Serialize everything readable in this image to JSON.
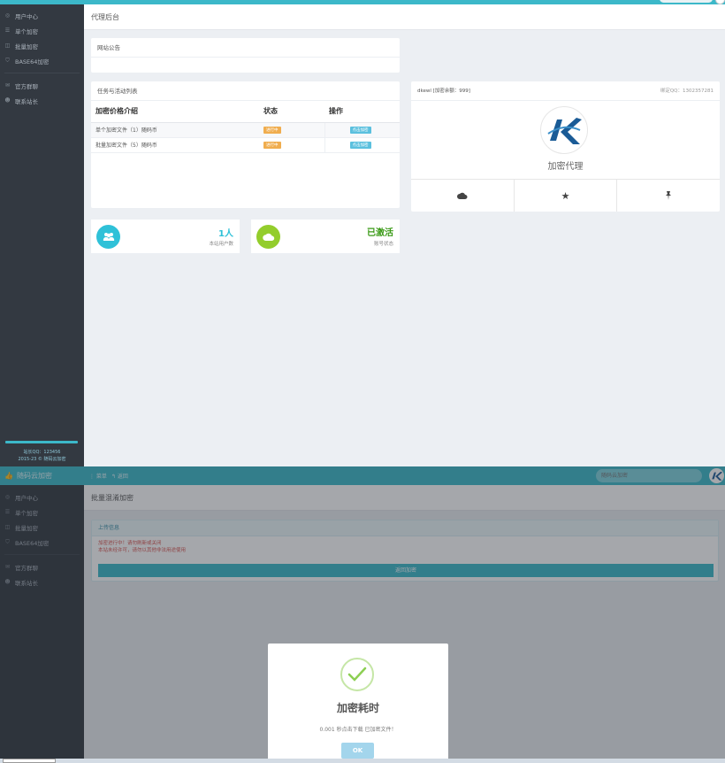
{
  "pane1": {
    "sidebar": {
      "items": [
        {
          "label": "用户中心",
          "icon": "user-circle-icon"
        },
        {
          "label": "单个加密",
          "icon": "list-icon"
        },
        {
          "label": "批量加密",
          "icon": "file-icon"
        },
        {
          "label": "BASE64加密",
          "icon": "shield-icon"
        }
      ],
      "items2": [
        {
          "label": "官方群聊",
          "icon": "chat-icon"
        },
        {
          "label": "联系站长",
          "icon": "user-group-icon"
        }
      ],
      "footer_qq": "站长QQ：123456",
      "footer_copy": "2015-23 © 随码云加密"
    },
    "page_title": "代理后台",
    "notice": {
      "title": "网站公告"
    },
    "tasks": {
      "title": "任务与活动列表",
      "headers": [
        "加密价格介绍",
        "状态",
        "操作"
      ],
      "rows": [
        {
          "name": "单个加密文件（1）随码币",
          "status": "进行中",
          "action": "点击加密"
        },
        {
          "name": "批量加密文件（5）随码币",
          "status": "进行中",
          "action": "点击加密"
        }
      ]
    },
    "profile": {
      "user": "dkewl [加密余额：999]",
      "qq": "绑定QQ：1302357281",
      "role": "加密代理"
    },
    "stats": [
      {
        "value": "1人",
        "label": "本站用户数",
        "icon": "users-icon",
        "color": "#2fc1d8"
      },
      {
        "value": "已激活",
        "label": "账号状态",
        "icon": "cloud-icon",
        "color": "#93cd2c"
      }
    ],
    "colors": {
      "accent": "#3cb8c9",
      "sidebar": "#333941",
      "warning": "#f0ad4e",
      "info": "#5bc0de"
    }
  },
  "pane2": {
    "brand": "随码云加密",
    "toolbar": {
      "menu": "菜单",
      "back": "返回"
    },
    "search_placeholder": "随码云加密",
    "sidebar": {
      "items": [
        {
          "label": "用户中心"
        },
        {
          "label": "单个加密"
        },
        {
          "label": "批量加密"
        },
        {
          "label": "BASE64加密"
        }
      ],
      "items2": [
        {
          "label": "官方群聊"
        },
        {
          "label": "联系站长"
        }
      ]
    },
    "page_title": "批量混淆加密",
    "upload": {
      "title": "上传信息",
      "line1": "加密进行中！请勿刷新或关闭",
      "line2": "本站未经许可，请勿以其他非法用途使用",
      "button": "返回加密"
    },
    "modal": {
      "title": "加密耗时",
      "text": "0.001 秒点击下载 已加密文件！",
      "ok": "OK"
    }
  }
}
